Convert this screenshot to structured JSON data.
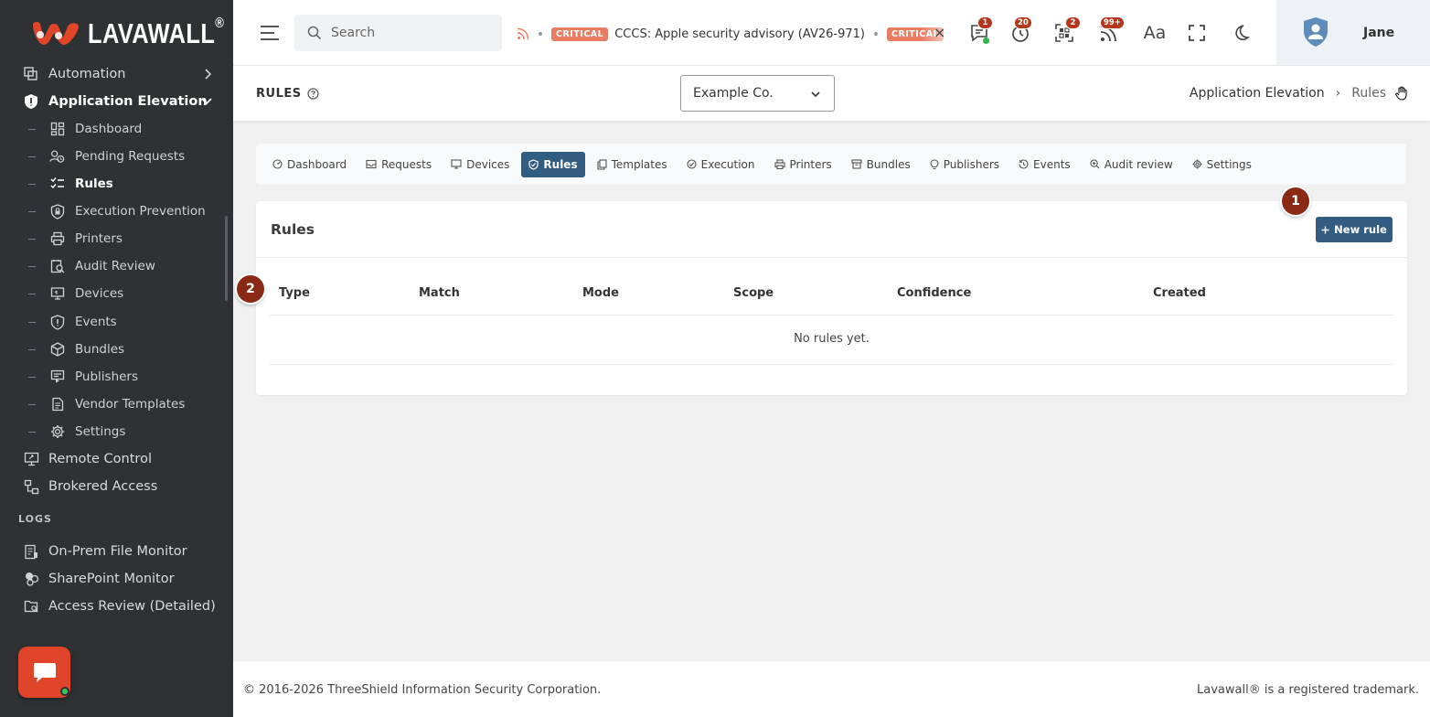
{
  "brand": {
    "name": "LAVAWALL",
    "reg": "®"
  },
  "sidebar": {
    "items": [
      {
        "label": "Automation",
        "icon": "automation-icon"
      },
      {
        "label": "Application Elevation",
        "icon": "shield-icon"
      },
      {
        "label": "Remote Control",
        "icon": "monitor-icon"
      },
      {
        "label": "Brokered Access",
        "icon": "network-icon"
      }
    ],
    "sub_items": [
      {
        "label": "Dashboard",
        "icon": "dashboard-icon"
      },
      {
        "label": "Pending Requests",
        "icon": "pending-icon"
      },
      {
        "label": "Rules",
        "icon": "rules-icon"
      },
      {
        "label": "Execution Prevention",
        "icon": "lock-shield-icon"
      },
      {
        "label": "Printers",
        "icon": "printer-icon"
      },
      {
        "label": "Audit Review",
        "icon": "audit-icon"
      },
      {
        "label": "Devices",
        "icon": "devices-icon"
      },
      {
        "label": "Events",
        "icon": "alert-shield-icon"
      },
      {
        "label": "Bundles",
        "icon": "box-icon"
      },
      {
        "label": "Publishers",
        "icon": "publisher-icon"
      },
      {
        "label": "Vendor Templates",
        "icon": "document-icon"
      },
      {
        "label": "Settings",
        "icon": "gear-icon"
      }
    ],
    "logs_label": "LOGS",
    "log_items": [
      {
        "label": "On-Prem File Monitor",
        "icon": "file-monitor-icon"
      },
      {
        "label": "SharePoint Monitor",
        "icon": "sharepoint-icon"
      },
      {
        "label": "Access Review (Detailed)",
        "icon": "folder-review-icon"
      }
    ]
  },
  "header": {
    "search_placeholder": "Search",
    "ticker": {
      "badge": "CRITICAL",
      "text": "CCCS: Apple security advisory (AV26-971)",
      "badge2": "CRITICAL",
      "close": "×"
    },
    "notifications": [
      {
        "icon": "chat-alert-icon",
        "count": "1"
      },
      {
        "icon": "timer-icon",
        "count": "20"
      },
      {
        "icon": "qr-icon",
        "count": "2"
      },
      {
        "icon": "feed-icon",
        "count": "99+"
      }
    ],
    "font_icon_label": "Aa",
    "user_name": "Jane"
  },
  "subheader": {
    "title": "RULES",
    "org_selected": "Example Co.",
    "breadcrumb": [
      "Application Elevation",
      "Rules"
    ],
    "breadcrumb_sep": "›"
  },
  "tabs": [
    {
      "label": "Dashboard",
      "icon": "dashboard-icon"
    },
    {
      "label": "Requests",
      "icon": "inbox-icon"
    },
    {
      "label": "Devices",
      "icon": "monitor-icon"
    },
    {
      "label": "Rules",
      "icon": "shield-icon",
      "active": true
    },
    {
      "label": "Templates",
      "icon": "copy-icon"
    },
    {
      "label": "Execution",
      "icon": "check-circle-icon"
    },
    {
      "label": "Printers",
      "icon": "printer-icon"
    },
    {
      "label": "Bundles",
      "icon": "archive-icon"
    },
    {
      "label": "Publishers",
      "icon": "bulb-icon"
    },
    {
      "label": "Events",
      "icon": "history-icon"
    },
    {
      "label": "Audit review",
      "icon": "search-plus-icon"
    },
    {
      "label": "Settings",
      "icon": "gear-icon"
    }
  ],
  "card": {
    "title": "Rules",
    "new_button": "New rule",
    "columns": [
      "Type",
      "Match",
      "Mode",
      "Scope",
      "Confidence",
      "Created"
    ],
    "empty_text": "No rules yet."
  },
  "markers": [
    "1",
    "2"
  ],
  "footer": {
    "copyright": "© 2016-2026 ThreeShield Information Security Corporation.",
    "trademark": "Lavawall® is a registered trademark."
  },
  "colors": {
    "sidebar_bg": "#2f3235",
    "accent": "#335d80",
    "critical": "#e97c63",
    "badge_red": "#b5361c",
    "brand_red": "#e0452a",
    "marker": "#8a2a15"
  }
}
